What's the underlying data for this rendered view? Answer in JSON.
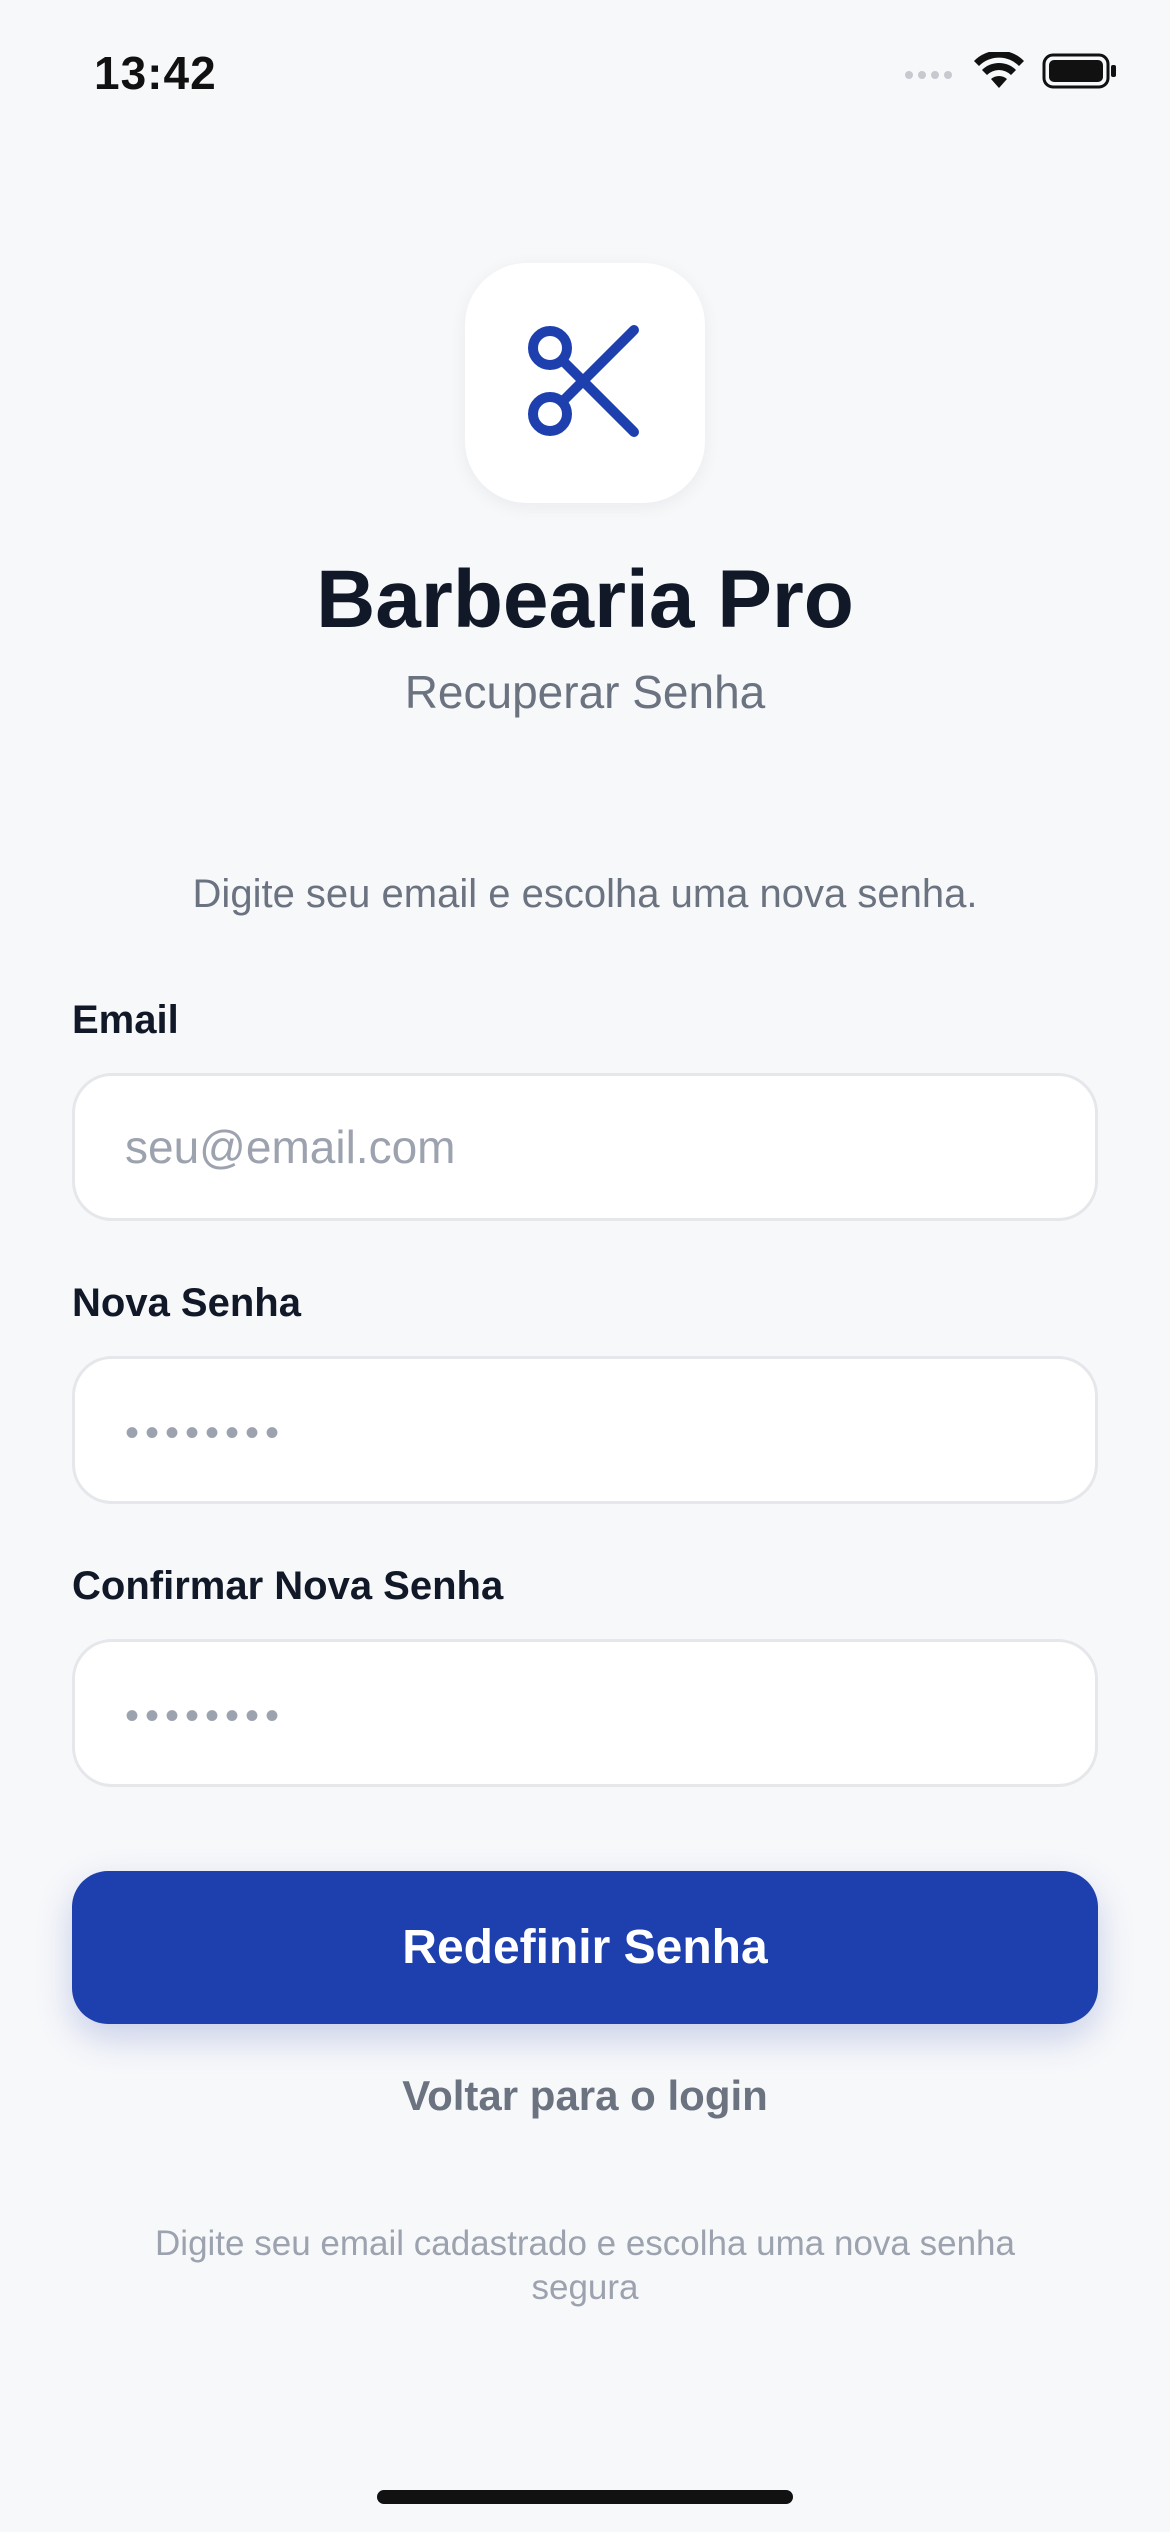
{
  "status_bar": {
    "time": "13:42",
    "icons": [
      "cellular-signal-icon",
      "wifi-icon",
      "battery-icon"
    ]
  },
  "logo": {
    "icon": "scissors-icon",
    "accent_color": "#1e40af"
  },
  "header": {
    "title": "Barbearia Pro",
    "subtitle": "Recuperar Senha"
  },
  "form": {
    "instructions": "Digite seu email e escolha uma nova senha.",
    "email": {
      "label": "Email",
      "placeholder": "seu@email.com",
      "value": ""
    },
    "new_password": {
      "label": "Nova Senha",
      "placeholder": "••••••••",
      "value": ""
    },
    "confirm_password": {
      "label": "Confirmar Nova Senha",
      "placeholder": "••••••••",
      "value": ""
    },
    "submit_label": "Redefinir Senha",
    "back_link_label": "Voltar para o login",
    "footer_note": "Digite seu email cadastrado e escolha uma nova senha segura"
  },
  "colors": {
    "background": "#f7f8fa",
    "primary": "#1e40af",
    "text_primary": "#111827",
    "text_secondary": "#6b7280",
    "text_muted": "#9ca3af"
  }
}
